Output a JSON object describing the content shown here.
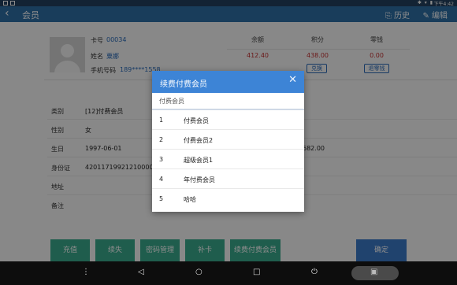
{
  "status_bar": {
    "clock": "下午4:42"
  },
  "header": {
    "back_icon": "back-arrow-icon",
    "title": "会员",
    "history_label": "历史",
    "edit_label": "编辑"
  },
  "profile": {
    "card_label": "卡号",
    "card_value": "00034",
    "name_label": "姓名",
    "name_value": "粟娜",
    "phone_label": "手机号码",
    "phone_value": "189****1558"
  },
  "stats": [
    {
      "label": "余额",
      "value": "412.40"
    },
    {
      "label": "积分",
      "value": "438.00",
      "action": "兑换"
    },
    {
      "label": "零钱",
      "value": "0.00",
      "action": "退零钱"
    }
  ],
  "details": [
    {
      "label": "类别",
      "value": "[12]付费会员"
    },
    {
      "label": "性别",
      "value": "女"
    },
    {
      "label": "生日",
      "value": "1997-06-01"
    },
    {
      "label": "身份证",
      "value": "420117199212100000"
    },
    {
      "label": "地址",
      "value": ""
    },
    {
      "label": "备注",
      "value": ""
    }
  ],
  "extra_value": "682.00",
  "bottom_buttons": [
    "充值",
    "续失",
    "密码管理",
    "补卡",
    "续费付费会员"
  ],
  "confirm_label": "确定",
  "dialog": {
    "title": "续费付费会员",
    "input_value": "付费会员",
    "options": [
      {
        "no": "1",
        "label": "付费会员"
      },
      {
        "no": "2",
        "label": "付费会员2"
      },
      {
        "no": "3",
        "label": "超级会员1"
      },
      {
        "no": "4",
        "label": "年付费会员"
      },
      {
        "no": "5",
        "label": "哈哈"
      }
    ]
  },
  "colors": {
    "header": "#2f6fa6",
    "dialog_header": "#3d84d6",
    "green_button": "#39a98d",
    "blue_button": "#3b7ac9",
    "amount": "#c43030"
  }
}
